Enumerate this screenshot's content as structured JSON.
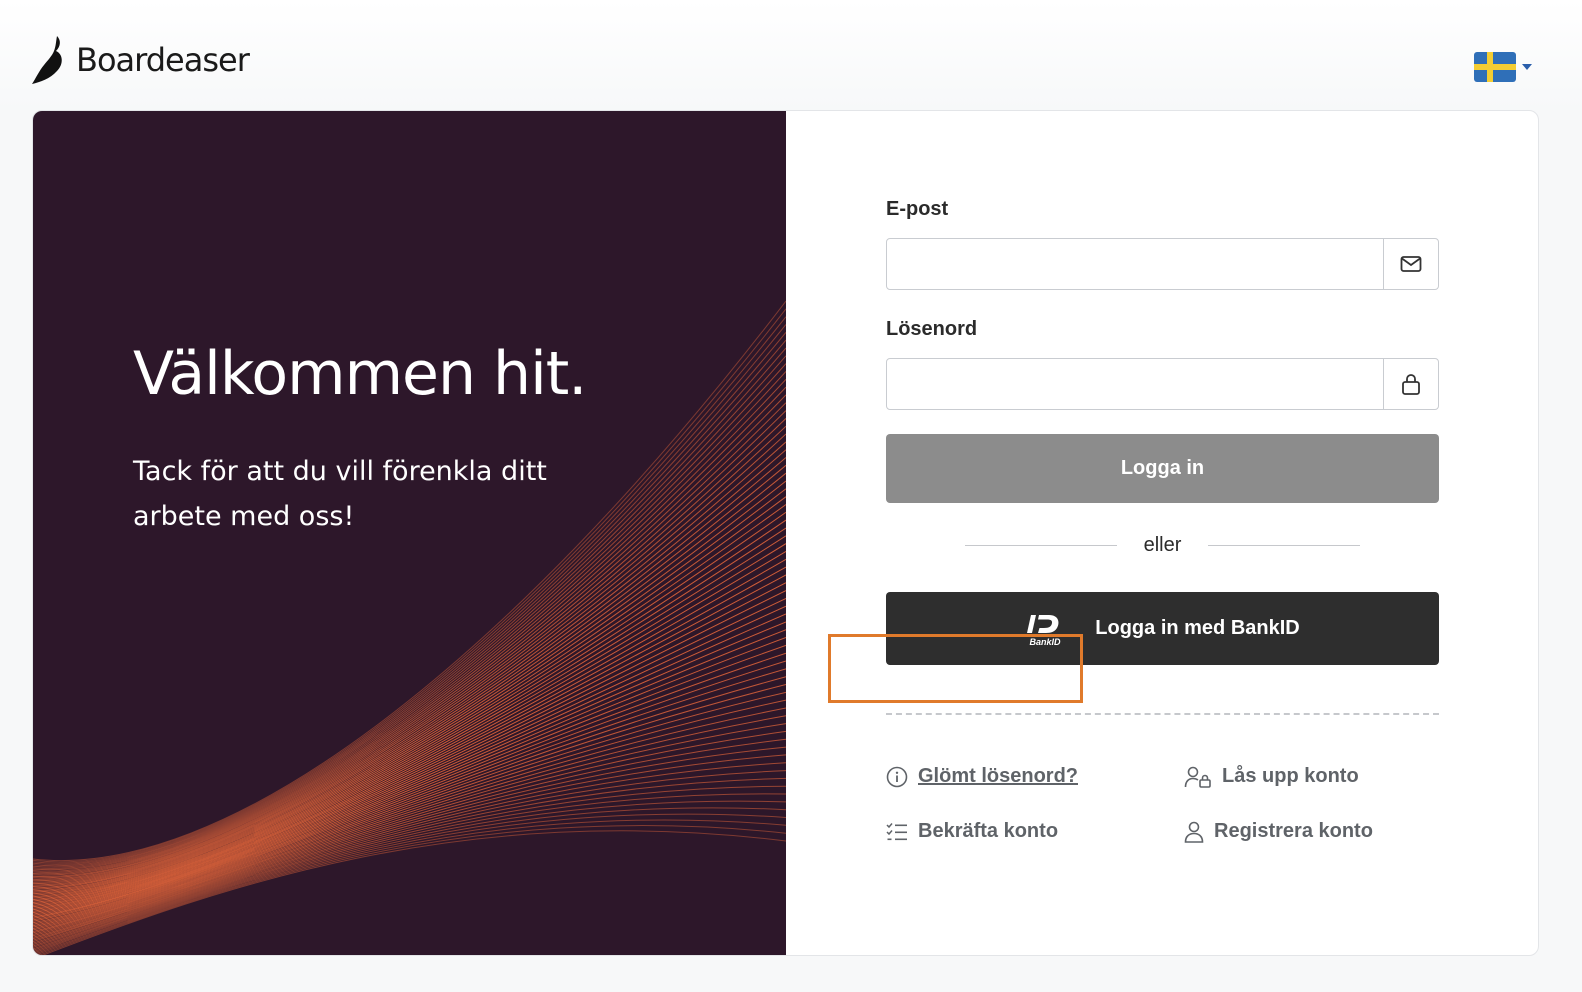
{
  "header": {
    "brand": "Boardeaser",
    "language_selector": {
      "flag": "sweden-flag-icon",
      "colors": {
        "blue": "#2f6fb8",
        "yellow": "#f3cd33"
      }
    }
  },
  "hero": {
    "title": "Välkommen hit.",
    "subtitle": "Tack för att du vill förenkla ditt arbete med oss!",
    "background_color": "#2d172a",
    "accent_color": "#e0643a"
  },
  "form": {
    "email": {
      "label": "E-post",
      "value": "",
      "placeholder": "",
      "icon": "envelope-icon"
    },
    "password": {
      "label": "Lösenord",
      "value": "",
      "placeholder": "",
      "icon": "lock-icon"
    },
    "login_button": "Logga in",
    "separator": "eller",
    "bankid_button": "Logga in med BankID",
    "bankid_logo_caption": "BankID"
  },
  "links": {
    "forgot_password": "Glömt lösenord?",
    "unlock_account": "Lås upp konto",
    "confirm_account": "Bekräfta konto",
    "register_account": "Registrera konto"
  },
  "annotation": {
    "highlight_color": "#e07a2b"
  }
}
